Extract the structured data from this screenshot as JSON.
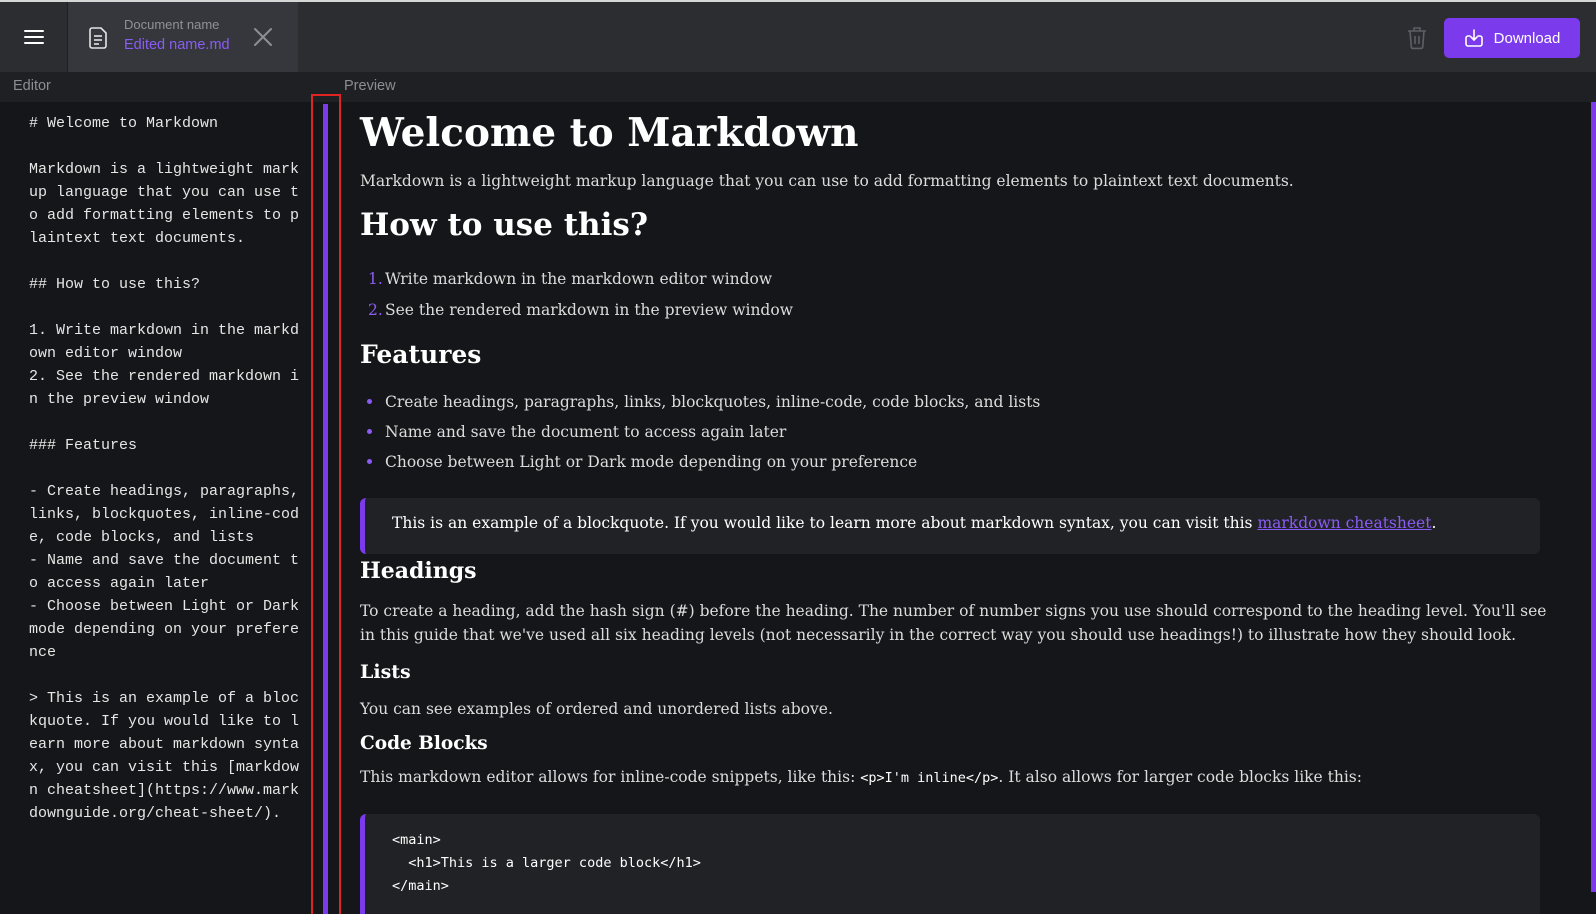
{
  "header": {
    "document_label": "Document name",
    "document_name": "Edited name.md",
    "download_label": "Download"
  },
  "labels": {
    "editor": "Editor",
    "preview": "Preview"
  },
  "editor": {
    "text": "# Welcome to Markdown\n\nMarkdown is a lightweight markup language that you can use to add formatting elements to plaintext text documents.\n\n## How to use this?\n\n1. Write markdown in the markdown editor window\n2. See the rendered markdown in the preview window\n\n### Features\n\n- Create headings, paragraphs, links, blockquotes, inline-code, code blocks, and lists\n- Name and save the document to access again later\n- Choose between Light or Dark mode depending on your preference\n\n> This is an example of a blockquote. If you would like to learn more about markdown syntax, you can visit this [markdown cheatsheet](https://www.markdownguide.org/cheat-sheet/)."
  },
  "preview": {
    "h1": "Welcome to Markdown",
    "intro": "Markdown is a lightweight markup language that you can use to add formatting elements to plaintext text documents.",
    "h2": "How to use this?",
    "ordered": [
      {
        "num": "1.",
        "text": "Write markdown in the markdown editor window"
      },
      {
        "num": "2.",
        "text": "See the rendered markdown in the preview window"
      }
    ],
    "h3": "Features",
    "bullets": [
      "Create headings, paragraphs, links, blockquotes, inline-code, code blocks, and lists",
      "Name and save the document to access again later",
      "Choose between Light or Dark mode depending on your preference"
    ],
    "quote_text": "This is an example of a blockquote. If you would like to learn more about markdown syntax, you can visit this ",
    "quote_link": "markdown cheatsheet",
    "quote_end": ".",
    "h4": "Headings",
    "headings_para": "To create a heading, add the hash sign (#) before the heading. The number of number signs you use should correspond to the heading level. You'll see in this guide that we've used all six heading levels (not necessarily in the correct way you should use headings!) to illustrate how they should look.",
    "h5": "Lists",
    "lists_para": "You can see examples of ordered and unordered lists above.",
    "h6": "Code Blocks",
    "code_para_before": "This markdown editor allows for inline-code snippets, like this: ",
    "inline_code": "<p>I'm inline</p>",
    "code_para_after": ". It also allows for larger code blocks like this:",
    "code_block": "<main>\n  <h1>This is a larger code block</h1>\n</main>"
  },
  "colors": {
    "accent": "#7c3aed",
    "link": "#8a5cf5",
    "topbar": "#2b2d31",
    "background": "#151619",
    "divider_highlight": "#e02424"
  },
  "icons": [
    "menu-icon",
    "document-icon",
    "close-icon",
    "trash-icon",
    "download-icon"
  ]
}
